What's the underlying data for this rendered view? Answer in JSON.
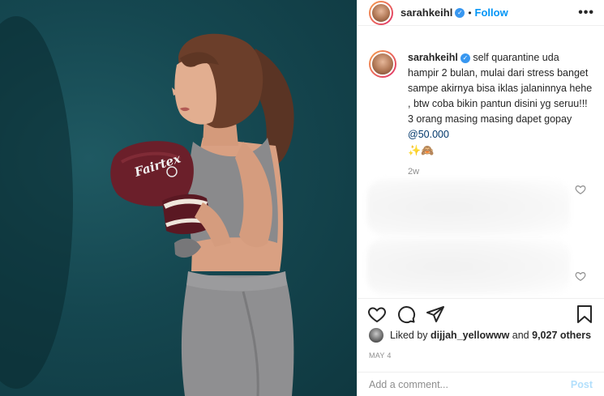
{
  "post": {
    "image_alt": "Woman in grey sportswear with maroon boxing gloves against teal background",
    "glove_brand": "Fairtex"
  },
  "header": {
    "username": "sarahkeihl",
    "separator": "•",
    "follow_label": "Follow",
    "more_label": "•••"
  },
  "caption": {
    "username": "sarahkeihl",
    "text": "self quarantine uda hampir 2 bulan, mulai dari stress banget sampe akirnya bisa iklas jalaninnya hehe , btw coba bikin pantun disini yg seruu!!! 3 orang masing masing dapet gopay ",
    "mention": "@50.000",
    "emojis": "✨🙈",
    "time": "2w"
  },
  "likes": {
    "prefix": "Liked by ",
    "user": "dijjah_yellowww",
    "middle": " and ",
    "count": "9,027 others"
  },
  "date": "MAY 4",
  "comment_box": {
    "placeholder": "Add a comment...",
    "post_label": "Post"
  },
  "colors": {
    "accent": "#0095f6",
    "verified": "#3897f0",
    "background_photo": "#154750",
    "glove": "#6b1f2a"
  },
  "icons": [
    "verified-badge-icon",
    "heart-icon",
    "comment-icon",
    "share-icon",
    "bookmark-icon",
    "more-icon"
  ]
}
